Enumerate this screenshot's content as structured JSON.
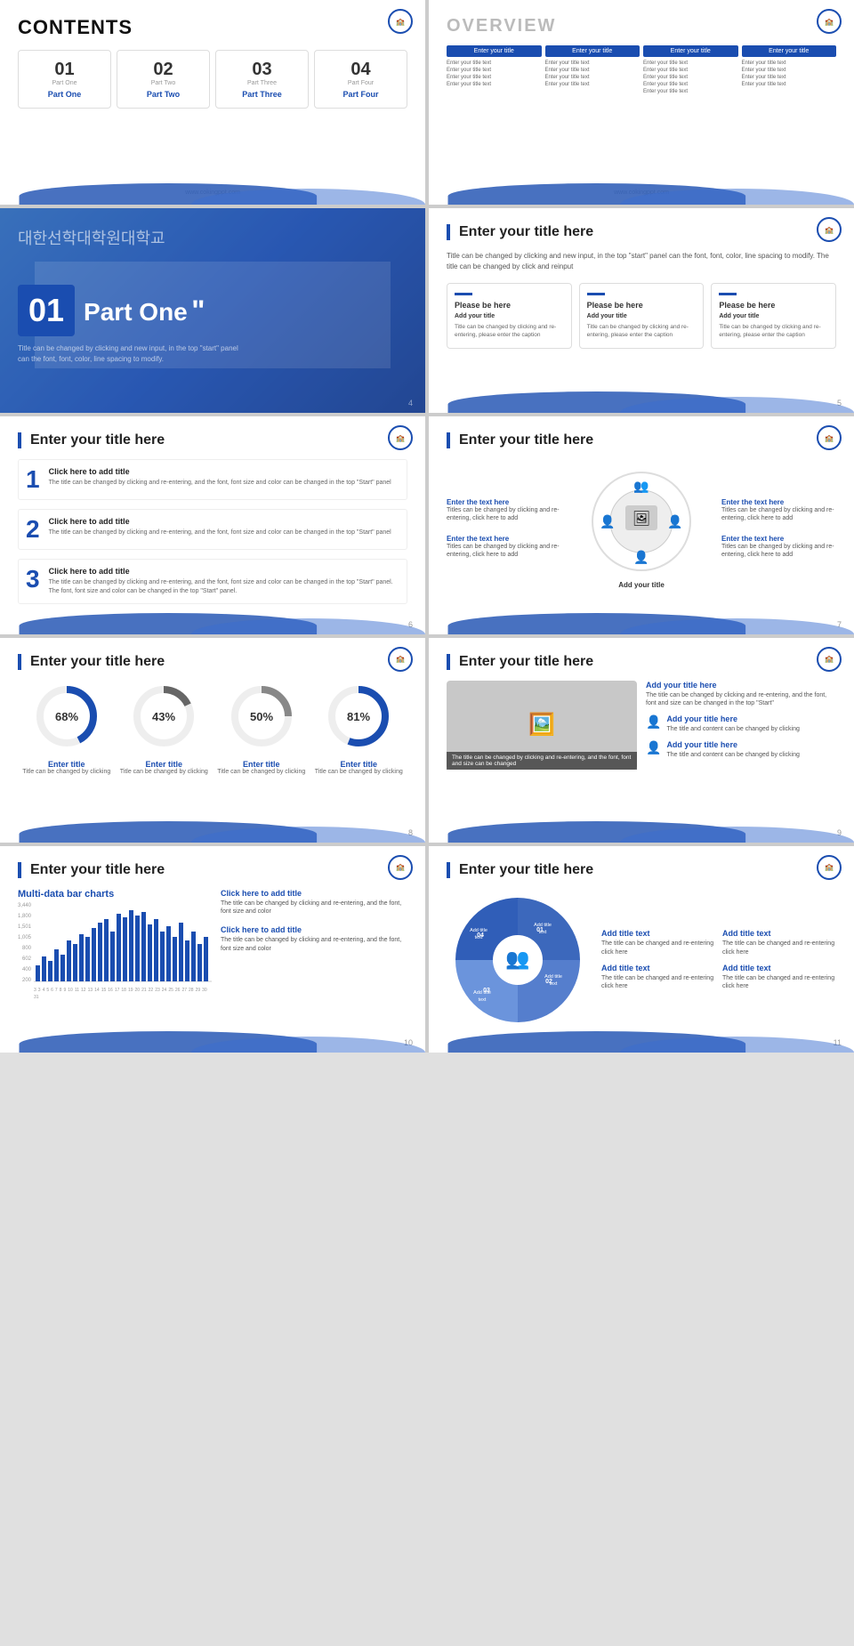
{
  "slides": [
    {
      "id": 1,
      "type": "contents",
      "title": "CONTENTS",
      "items": [
        {
          "num": "01",
          "label": "Part One",
          "name": "Part One"
        },
        {
          "num": "02",
          "label": "Part Two",
          "name": "Part Two"
        },
        {
          "num": "03",
          "label": "Part Three",
          "name": "Part Three"
        },
        {
          "num": "04",
          "label": "Part Four",
          "name": "Part Four"
        }
      ],
      "watermark": "www.cokingppt.com"
    },
    {
      "id": 2,
      "type": "overview",
      "title": "OVERVIEW",
      "columns": [
        {
          "header": "Enter your title",
          "rows": [
            "Enter your title text",
            "Enter your title text",
            "Enter your title text",
            "Enter your title text"
          ]
        },
        {
          "header": "Enter your title",
          "rows": [
            "Enter your title text",
            "Enter your title text",
            "Enter your title text",
            "Enter your title text"
          ]
        },
        {
          "header": "Enter your title",
          "rows": [
            "Enter your title text",
            "Enter your title text",
            "Enter your title text",
            "Enter your title text",
            "Enter your title text"
          ]
        },
        {
          "header": "Enter your title",
          "rows": [
            "Enter your title text",
            "Enter your title text",
            "Enter your title text",
            "Enter your title text"
          ]
        }
      ],
      "watermark": "www.cokingppt.com"
    },
    {
      "id": 3,
      "type": "part-intro",
      "korean": "대한선학대학원대학교",
      "num": "01",
      "part": "Part One",
      "quote": "\"",
      "subtitle": "Title can be changed by clicking and new input, in the top \"start\" panel can the font, font, color, line spacing to modify."
    },
    {
      "id": 4,
      "type": "content-slide",
      "section_title": "Enter your title here",
      "description": "Title can be changed by clicking and new input, in the top \"start\" panel can the font, font, color, line spacing to modify. The title can be changed by click and reinput",
      "cards": [
        {
          "title": "Please be here",
          "subtitle": "Add your title",
          "text": "Title can be changed by clicking and re-entering, please enter the caption"
        },
        {
          "title": "Please be here",
          "subtitle": "Add your title",
          "text": "Title can be changed by clicking and re-entering, please enter the caption"
        },
        {
          "title": "Please be here",
          "subtitle": "Add your title",
          "text": "Title can be changed by clicking and re-entering, please enter the caption"
        }
      ],
      "page": "5"
    },
    {
      "id": 5,
      "type": "numbered-list",
      "section_title": "Enter your title here",
      "items": [
        {
          "num": "1",
          "title": "Click here to add title",
          "text": "The title can be changed by clicking and re-entering, and the font, font size and color can be changed in the top \"Start\" panel"
        },
        {
          "num": "2",
          "title": "Click here to add title",
          "text": "The title can be changed by clicking and re-entering, and the font, font size and color can be changed in the top \"Start\" panel"
        },
        {
          "num": "3",
          "title": "Click here to add title",
          "text": "The title can be changed by clicking and re-entering, and the font, font size and color can be changed in the top \"Start\" panel. The font, font size and color can be changed in the top \"Start\" panel."
        }
      ],
      "page": "6"
    },
    {
      "id": 6,
      "type": "circle-diagram",
      "section_title": "Enter your title here",
      "left_items": [
        {
          "title": "Enter the text here",
          "text": "Titles can be changed by clicking and re-entering, click here to add"
        },
        {
          "title": "Enter the text here",
          "text": "Titles can be changed by clicking and re-entering, click here to add"
        }
      ],
      "right_items": [
        {
          "title": "Enter the text here",
          "text": "Titles can be changed by clicking and re-entering, click here to add"
        },
        {
          "title": "Enter the text here",
          "text": "Titles can be changed by clicking and re-entering, click here to add"
        }
      ],
      "center_label": "Add your title",
      "page": "7"
    },
    {
      "id": 7,
      "type": "donut-charts",
      "section_title": "Enter your title here",
      "charts": [
        {
          "value": 68,
          "label": "Enter title",
          "sublabel": "Title can be changed by clicking"
        },
        {
          "value": 43,
          "label": "Enter title",
          "sublabel": "Title can be changed by clicking"
        },
        {
          "value": 50,
          "label": "Enter title",
          "sublabel": "Title can be changed by clicking"
        },
        {
          "value": 81,
          "label": "Enter title",
          "sublabel": "Title can be changed by clicking"
        }
      ],
      "page": "8"
    },
    {
      "id": 8,
      "type": "image-list",
      "section_title": "Enter your title here",
      "image_caption": "The title can be changed by clicking and re-entering, and the font, font and size can be changed",
      "items": [
        {
          "title": "Add your title here",
          "text": "The title can be changed by clicking and re-entering, and the font, font and size can be changed in the top \"Start\""
        },
        {
          "title": "Add your title here",
          "text": "The title and content can be changed by clicking"
        },
        {
          "title": "Add your title here",
          "text": "The title and content can be changed by clicking"
        }
      ],
      "page": "9"
    },
    {
      "id": 9,
      "type": "bar-chart",
      "section_title": "Enter your title here",
      "chart_title": "Multi-data bar charts",
      "bar_values": [
        30,
        45,
        35,
        50,
        40,
        60,
        55,
        70,
        65,
        75,
        80,
        85,
        70,
        90,
        85,
        95,
        88,
        92,
        78,
        85,
        70,
        75,
        65,
        80,
        60,
        70,
        55,
        65,
        50,
        45
      ],
      "y_labels": [
        "3,440",
        "1,800",
        "1,501",
        "1,005",
        "800",
        "602",
        "400",
        "200"
      ],
      "x_labels": [
        "3",
        "3",
        "4",
        "5",
        "6",
        "7",
        "8",
        "9",
        "10",
        "11",
        "12",
        "13",
        "14",
        "15",
        "16",
        "17",
        "18",
        "19",
        "20",
        "21",
        "22",
        "23",
        "24",
        "25",
        "26",
        "27",
        "28",
        "29",
        "30",
        "31"
      ],
      "click_items": [
        {
          "title": "Click here to add title",
          "text": "The title can be changed by clicking and re-entering, and the font, font size and color"
        },
        {
          "title": "Click here to add title",
          "text": "The title can be changed by clicking and re-entering, and the font, font size and color"
        }
      ],
      "page": "10"
    },
    {
      "id": 10,
      "type": "cycle-diagram",
      "section_title": "Enter your title here",
      "segments": [
        {
          "num": "01",
          "label": "Add title text"
        },
        {
          "num": "02",
          "label": "Add title text"
        },
        {
          "num": "03",
          "label": "Add title text"
        },
        {
          "num": "04",
          "label": "Add title text"
        }
      ],
      "items": [
        {
          "title": "Add title text",
          "text": "The title can be changed and re-entering click here"
        },
        {
          "title": "Add title text",
          "text": "The title can be changed and re-entering click here"
        },
        {
          "title": "Add title text",
          "text": "The title can be changed and re-entering click here"
        },
        {
          "title": "Add title text",
          "text": "The title can be changed and re-entering click here"
        }
      ],
      "page": "11"
    }
  ]
}
